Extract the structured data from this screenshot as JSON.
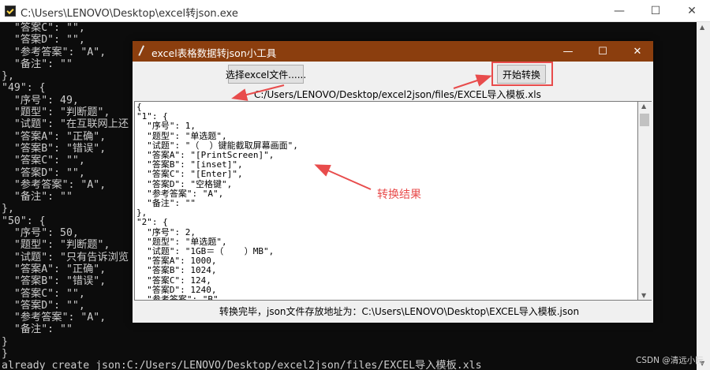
{
  "console": {
    "title": "C:\\Users\\LENOVO\\Desktop\\excel转json.exe",
    "lines": [
      "  \"答案C\": \"\",",
      "  \"答案D\": \"\",",
      "  \"参考答案\": \"A\",",
      "  \"备注\": \"\"",
      "},",
      "\"49\": {",
      "  \"序号\": 49,",
      "  \"题型\": \"判断题\",",
      "  \"试题\": \"在互联网上还",
      "  \"答案A\": \"正确\",",
      "  \"答案B\": \"错误\",",
      "  \"答案C\": \"\",",
      "  \"答案D\": \"\",",
      "  \"参考答案\": \"A\",",
      "  \"备注\": \"\"",
      "},",
      "\"50\": {",
      "  \"序号\": 50,",
      "  \"题型\": \"判断题\",",
      "  \"试题\": \"只有告诉浏览",
      "  \"答案A\": \"正确\",",
      "  \"答案B\": \"错误\",",
      "  \"答案C\": \"\",",
      "  \"答案D\": \"\",",
      "  \"参考答案\": \"A\",",
      "  \"备注\": \"\"",
      "}",
      "}",
      "already create json:C:/Users/LENOVO/Desktop/excel2json/files/EXCEL导入模板.xls"
    ]
  },
  "tool": {
    "title": "excel表格数据转json小工具",
    "select_label": "选择excel文件......",
    "convert_label": "开始转换",
    "file_path": "C:/Users/LENOVO/Desktop/excel2json/files/EXCEL导入模板.xls",
    "result_lines": [
      "{",
      "\"1\": {",
      "  \"序号\": 1,",
      "  \"题型\": \"单选题\",",
      "  \"试题\": \"（  ）键能截取屏幕画面\",",
      "  \"答案A\": \"[PrintScreen]\",",
      "  \"答案B\": \"[inset]\",",
      "  \"答案C\": \"[Enter]\",",
      "  \"答案D\": \"空格键\",",
      "  \"参考答案\": \"A\",",
      "  \"备注\": \"\"",
      "},",
      "\"2\": {",
      "  \"序号\": 2,",
      "  \"题型\": \"单选题\",",
      "  \"试题\": \"1GB＝（    ）MB\",",
      "  \"答案A\": 1000,",
      "  \"答案B\": 1024,",
      "  \"答案C\": 124,",
      "  \"答案D\": 1240,",
      "  \"参考答案\": \"B\","
    ],
    "status": "转换完毕，json文件存放地址为：C:\\Users\\LENOVO\\Desktop\\EXCEL导入模板.json"
  },
  "annotation": {
    "label": "转换结果",
    "color": "#e84c4c"
  },
  "watermark": "CSDN @清远小阮",
  "colors": {
    "tool_titlebar": "#8b3e0e",
    "console_bg": "#0c0c0c",
    "console_text": "#cccccc"
  }
}
